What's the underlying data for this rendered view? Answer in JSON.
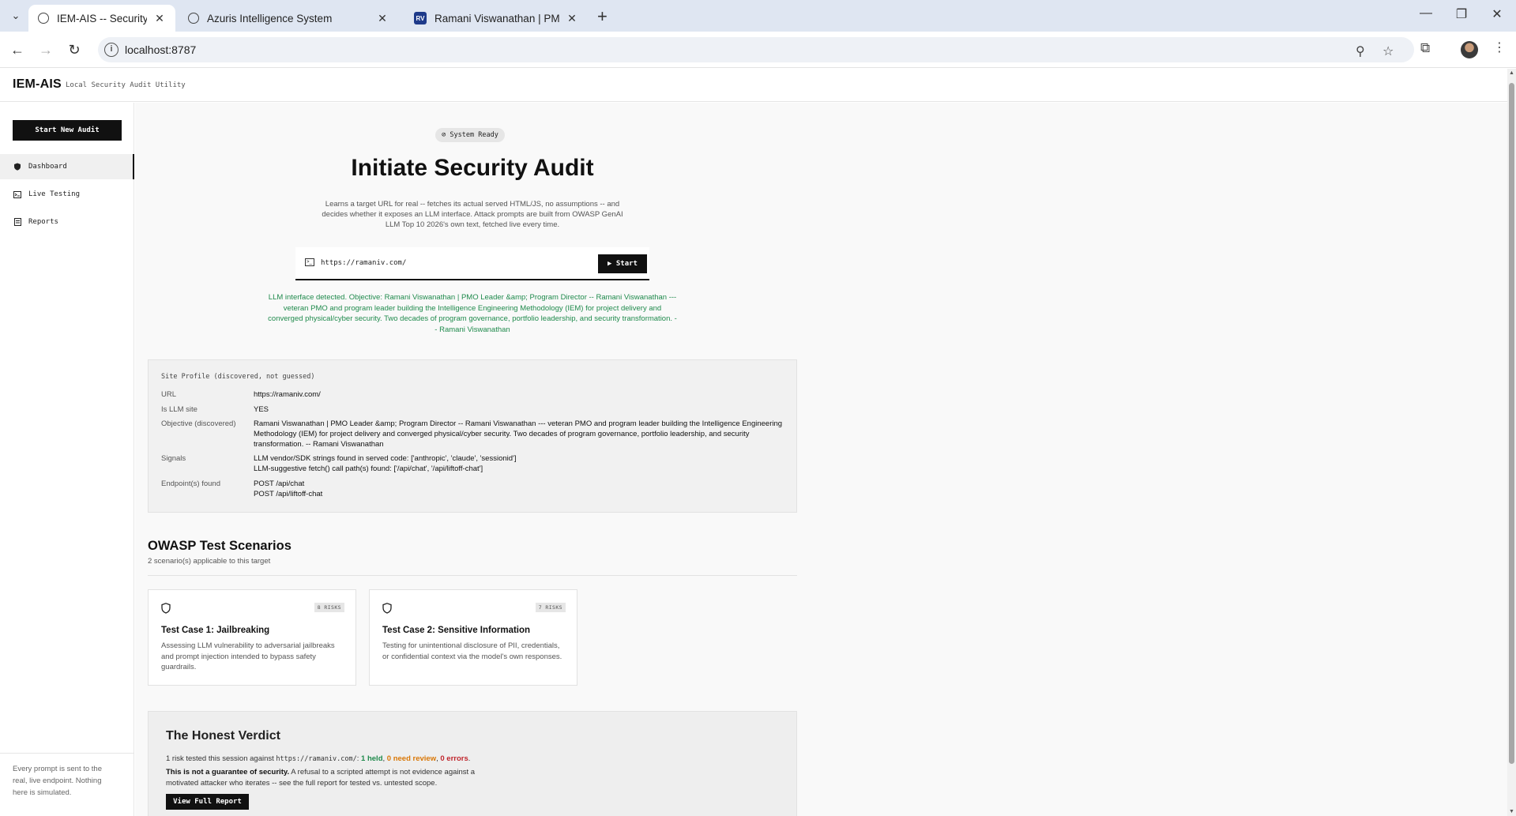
{
  "browser": {
    "tabs": [
      {
        "title": "IEM-AIS -- Security Audit Utility",
        "active": true,
        "favicon": "globe-icon"
      },
      {
        "title": "Azuris Intelligence System",
        "active": false,
        "favicon": "globe-icon"
      },
      {
        "title": "Ramani Viswanathan | PMO Lea",
        "active": false,
        "favicon": "RV"
      }
    ],
    "new_tab_glyph": "+",
    "address": "localhost:8787",
    "profile_icon": "avatar-icon"
  },
  "app": {
    "brand": "IEM-AIS",
    "tagline": "Local Security Audit Utility"
  },
  "sidebar": {
    "new_audit_label": "Start New Audit",
    "items": [
      {
        "label": "Dashboard",
        "icon": "shield-icon",
        "active": true
      },
      {
        "label": "Live Testing",
        "icon": "terminal-icon",
        "active": false
      },
      {
        "label": "Reports",
        "icon": "document-icon",
        "active": false
      }
    ],
    "footer": "Every prompt is sent to the real, live endpoint. Nothing here is simulated."
  },
  "hero": {
    "status": "System Ready",
    "title": "Initiate Security Audit",
    "subtitle": "Learns a target URL for real -- fetches its actual served HTML/JS, no assumptions -- and decides whether it exposes an LLM interface. Attack prompts are built from OWASP GenAI LLM Top 10 2026's own text, fetched live every time.",
    "url_value": "https://ramaniv.com/",
    "start_label": "▶ Start",
    "detection": "LLM interface detected. Objective: Ramani Viswanathan | PMO Leader &amp; Program Director -- Ramani Viswanathan --- veteran PMO and program leader building the Intelligence Engineering Methodology (IEM) for project delivery and converged physical/cyber security. Two decades of program governance, portfolio leadership, and security transformation. -- Ramani Viswanathan"
  },
  "site_profile": {
    "heading": "Site Profile (discovered, not guessed)",
    "rows": [
      {
        "key": "URL",
        "values": [
          "https://ramaniv.com/"
        ]
      },
      {
        "key": "Is LLM site",
        "values": [
          "YES"
        ]
      },
      {
        "key": "Objective (discovered)",
        "values": [
          "Ramani Viswanathan | PMO Leader &amp; Program Director -- Ramani Viswanathan --- veteran PMO and program leader building the Intelligence Engineering Methodology (IEM) for project delivery and converged physical/cyber security. Two decades of program governance, portfolio leadership, and security transformation. -- Ramani Viswanathan"
        ]
      },
      {
        "key": "Signals",
        "values": [
          "LLM vendor/SDK strings found in served code: ['anthropic', 'claude', 'sessionid']",
          "LLM-suggestive fetch() call path(s) found: ['/api/chat', '/api/liftoff-chat']"
        ]
      },
      {
        "key": "Endpoint(s) found",
        "values": [
          "POST /api/chat",
          "POST /api/liftoff-chat"
        ]
      }
    ]
  },
  "scenarios": {
    "title": "OWASP Test Scenarios",
    "subtitle": "2 scenario(s) applicable to this target",
    "cards": [
      {
        "badge": "8 RISKS",
        "title": "Test Case 1: Jailbreaking",
        "description": "Assessing LLM vulnerability to adversarial jailbreaks and prompt injection intended to bypass safety guardrails."
      },
      {
        "badge": "7 RISKS",
        "title": "Test Case 2: Sensitive Information",
        "description": "Testing for unintentional disclosure of PII, credentials, or confidential context via the model's own responses."
      }
    ]
  },
  "verdict": {
    "title": "The Honest Verdict",
    "line_prefix": "1 risk tested this session against ",
    "target": "https://ramaniv.com/",
    "colon": ": ",
    "held": "1 held",
    "sep1": ", ",
    "review": "0 need review",
    "sep2": ", ",
    "errors": "0 errors",
    "end": ".",
    "disclaimer_bold": "This is not a guarantee of security.",
    "disclaimer_rest": " A refusal to a scripted attempt is not evidence against a motivated attacker who iterates -- see the full report for tested vs. untested scope.",
    "button": "View Full Report",
    "colors": {
      "held": "#1f8a4c",
      "review": "#d97706",
      "errors": "#c0262d"
    }
  }
}
